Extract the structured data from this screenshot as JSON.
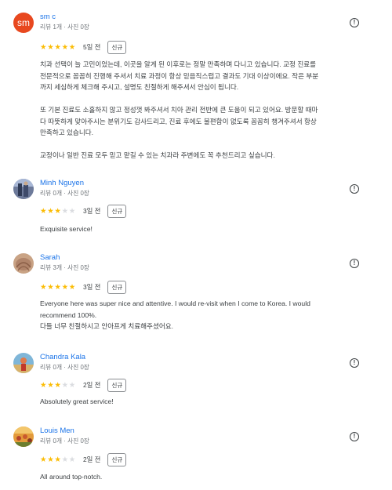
{
  "common": {
    "new_badge": "신규",
    "more_icon_char": "!"
  },
  "reviews": [
    {
      "author": "sm c",
      "avatar_letters": "sm",
      "avatar_color": "#e8481f",
      "meta": "리뷰 1개 · 사진 0장",
      "rating": 5,
      "date": "5일 전",
      "paragraphs": [
        "치과 선택이 늘 고민이었는데, 이곳을 알게 된 이후로는 정말 만족하며 다니고 있습니다. 교정 진료를\n전문적으로 꼼꼼히 진행해 주셔서 치료 과정이 항상 믿음직스럽고 결과도 기대 이상이에요. 작은 부분\n까지 세심하게 체크해 주시고, 설명도 친절하게 해주셔서 안심이 됩니다.",
        "또 기본 진료도 소홀하지 않고 정성껏 봐주셔서 치아 관리 전반에 큰 도움이 되고 있어요. 방문할 때마\n다 따뜻하게 맞아주시는 분위기도 감사드리고, 진료 후에도 불편함이 없도록 꼼꼼히 챙겨주셔서 항상\n만족하고 있습니다.",
        "교정이나 일반 진료 모두 믿고 맡길 수 있는 치과라 주변에도 꼭 추천드리고 싶습니다."
      ]
    },
    {
      "author": "Minh Nguyen",
      "meta": "리뷰 0개 · 사진 0장",
      "rating": 3,
      "date": "3일 전",
      "paragraphs": [
        "Exquisite service!"
      ]
    },
    {
      "author": "Sarah",
      "meta": "리뷰 3개 · 사진 0장",
      "rating": 5,
      "date": "3일 전",
      "paragraphs": [
        "Everyone here was super nice and attentive. I would re-visit when I come to Korea. I would\nrecommend 100%.\n다들 너무 친절하시고 안아프게 치료해주셨어요."
      ]
    },
    {
      "author": "Chandra Kala",
      "meta": "리뷰 0개 · 사진 0장",
      "rating": 3,
      "date": "2일 전",
      "paragraphs": [
        "Absolutely great service!"
      ]
    },
    {
      "author": "Louis Men",
      "meta": "리뷰 0개 · 사진 0장",
      "rating": 3,
      "date": "2일 전",
      "paragraphs": [
        "All around top-notch."
      ]
    }
  ]
}
